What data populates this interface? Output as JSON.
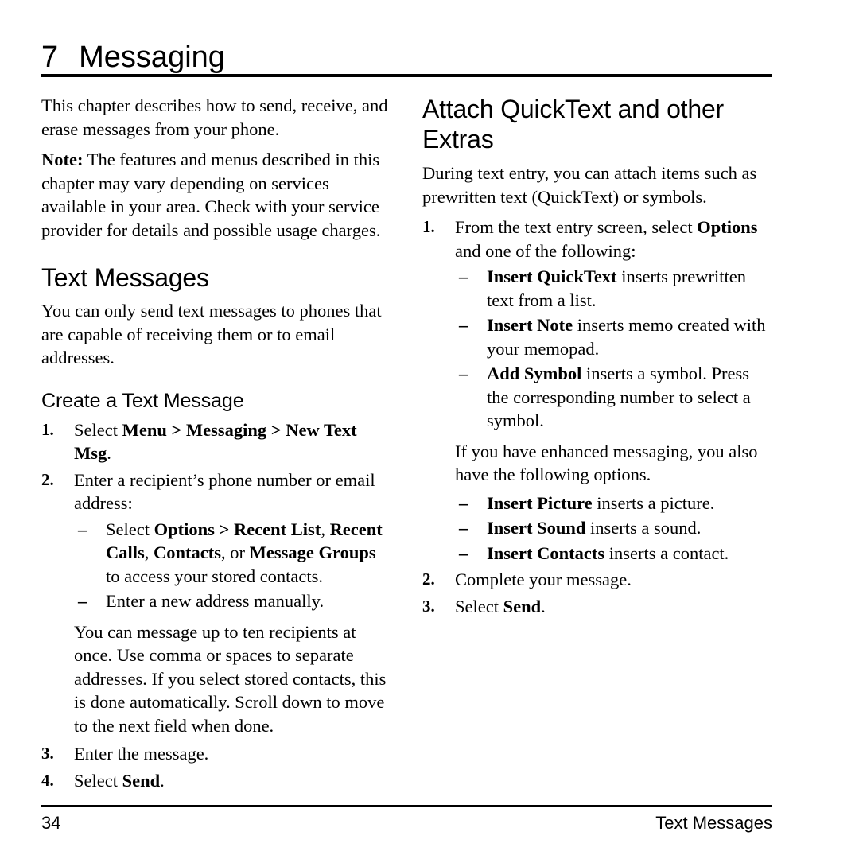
{
  "document": {
    "chapter_number": "7",
    "chapter_title": "Messaging"
  },
  "left_column": {
    "intro_paragraph": "This chapter describes how to send, receive, and erase messages from your phone.",
    "note_label": "Note:",
    "note_text": " The features and menus described in this chapter may vary depending on services available in your area. Check with your service provider for details and possible usage charges.",
    "heading_text_messages": "Text Messages",
    "text_messages_paragraph": "You can only send text messages to phones that are capable of receiving them or to email addresses.",
    "heading_create_a_text_message": "Create a Text Message",
    "steps": [
      {
        "number": "1.",
        "prefix": "Select ",
        "bold": "Menu > Messaging > New Text Msg",
        "suffix": "."
      },
      {
        "number": "2.",
        "text": "Enter a recipient’s phone number or email address:"
      },
      {
        "number": "3.",
        "text": "Enter the message."
      },
      {
        "number": "4.",
        "prefix": "Select ",
        "bold": "Send",
        "suffix": "."
      }
    ],
    "step2_dashes": [
      {
        "mark": "–",
        "part1": "Select ",
        "bold1": "Options > Recent List",
        "part2": ", ",
        "bold2": "Recent Calls",
        "part3": ", ",
        "bold3": "Contacts",
        "part4": ", or ",
        "bold4": "Message Groups",
        "part5": " to access your stored contacts."
      },
      {
        "mark": "–",
        "part1": "Enter a new address manually.",
        "bold1": "",
        "part2": "",
        "bold2": "",
        "part3": "",
        "bold3": "",
        "part4": "",
        "bold4": "",
        "part5": ""
      }
    ],
    "step2_paragraph": "You can message up to ten recipients at once. Use comma or spaces to separate addresses. If you select stored contacts, this is done automatically. Scroll down to move to the next field when done."
  },
  "right_column": {
    "heading_attach": "Attach QuickText and other Extras",
    "attach_paragraph": "During text entry, you can attach items such as prewritten text (QuickText) or symbols.",
    "steps": [
      {
        "number": "1.",
        "prefix": "From the text entry screen, select ",
        "bold": "Options",
        "suffix": " and one of the following:"
      },
      {
        "number": "2.",
        "prefix": "Complete your message.",
        "bold": "",
        "suffix": ""
      },
      {
        "number": "3.",
        "prefix": "Select ",
        "bold": "Send",
        "suffix": "."
      }
    ],
    "step1_dashes": [
      {
        "mark": "–",
        "bold": "Insert QuickText",
        "rest": " inserts prewritten text from a list."
      },
      {
        "mark": "–",
        "bold": "Insert Note",
        "rest": " inserts memo created with your memopad."
      },
      {
        "mark": "–",
        "bold": "Add Symbol",
        "rest": " inserts a symbol. Press the corresponding number to select a symbol."
      }
    ],
    "enhanced_paragraph": "If you have enhanced messaging, you also have the following options.",
    "enhanced_dashes": [
      {
        "mark": "–",
        "bold": "Insert Picture",
        "rest": " inserts a picture."
      },
      {
        "mark": "–",
        "bold": "Insert Sound",
        "rest": " inserts a sound."
      },
      {
        "mark": "–",
        "bold": "Insert Contacts",
        "rest": " inserts a contact."
      }
    ]
  },
  "footer": {
    "page_number": "34",
    "section_label": "Text Messages"
  }
}
